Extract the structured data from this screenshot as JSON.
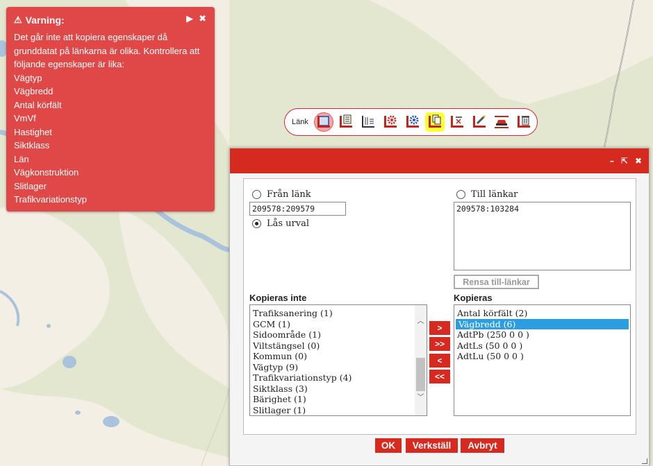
{
  "warning": {
    "title": "Varning:",
    "icon": "warning-triangle-icon",
    "message": "Det går inte att kopiera egenskaper då grunddatat på länkarna är olika. Kontrollera att följande egenskaper är lika:",
    "items": [
      "Vägtyp",
      "Vägbredd",
      "Antal körfält",
      "VmVf",
      "Hastighet",
      "Siktklass",
      "Län",
      "Vägkonstruktion",
      "Slitlager",
      "Trafikvariationstyp"
    ],
    "play_glyph": "▶",
    "close_glyph": "✖"
  },
  "toolbar": {
    "label": "Länk"
  },
  "dialog": {
    "minimize_glyph": "–",
    "popout_glyph": "⇱",
    "close_glyph": "✖",
    "from_link": {
      "label": "Från länk",
      "value": "209578:209579"
    },
    "lock": {
      "label": "Lås urval"
    },
    "to_links": {
      "label": "Till länkar",
      "value": "209578:103284"
    },
    "clear_button": "Rensa till-länkar",
    "not_copied": {
      "title": "Kopieras inte",
      "items": [
        "Trafiksanering (1)",
        "GCM (1)",
        "Sidoområde (1)",
        "Viltstängsel (0)",
        "Kommun (0)",
        "Vägtyp (9)",
        "Trafikvariationstyp (4)",
        "Siktklass (3)",
        "Bärighet (1)",
        "Slitlager (1)"
      ]
    },
    "copied": {
      "title": "Kopieras",
      "items": [
        "Antal körfält (2)",
        "Vägbredd (6)",
        "AdtPb (250 0 0 )",
        "AdtLs (50 0 0 )",
        "AdtLu (50 0 0 )"
      ],
      "selected_index": 1
    },
    "move_buttons": [
      ">",
      ">>",
      "<",
      "<<"
    ],
    "footer": {
      "ok": "OK",
      "apply": "Verkställ",
      "cancel": "Avbryt"
    }
  },
  "colors": {
    "accent": "#d6291f",
    "warning": "#e04848",
    "selection": "#2b9de0",
    "highlight": "#ffff33"
  }
}
